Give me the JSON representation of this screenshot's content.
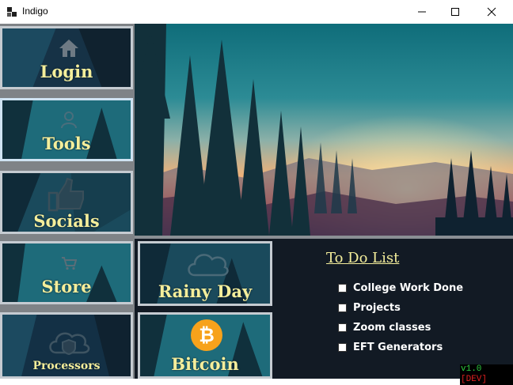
{
  "window": {
    "title": "Indigo"
  },
  "nav": {
    "login": "Login",
    "tools": "Tools",
    "socials": "Socials",
    "store": "Store",
    "processors": "Processors"
  },
  "widgets": {
    "rainy_day": "Rainy Day",
    "bitcoin": "Bitcoin",
    "bitcoin_symbol": "₿"
  },
  "todo": {
    "title": "To Do List",
    "items": [
      "College Work Done",
      "Projects",
      "Zoom classes",
      "EFT Generators"
    ]
  },
  "status": {
    "version": "v1.0",
    "build": "[DEV]"
  },
  "colors": {
    "label": "#f4ee9b",
    "tile_border": "#c5cbd1",
    "version_green": "#2ecc40",
    "dev_red": "#e02020"
  }
}
